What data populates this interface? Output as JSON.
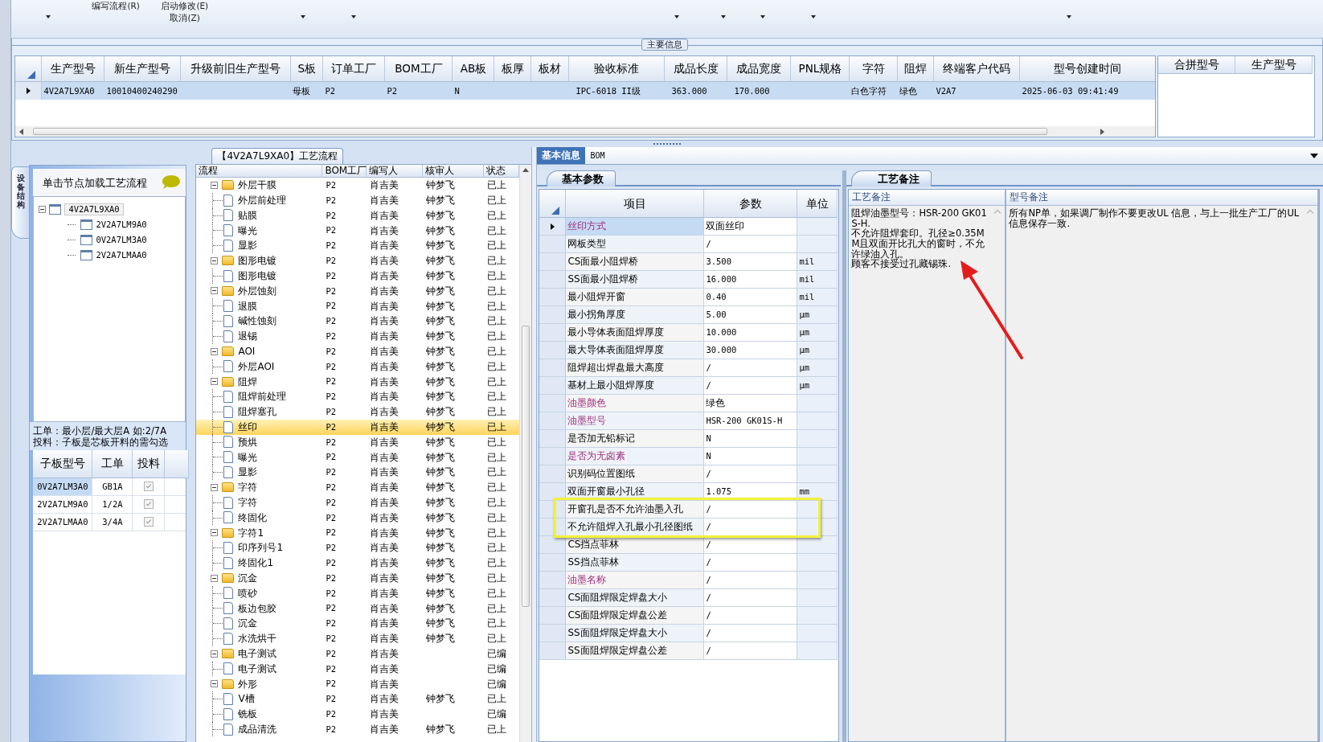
{
  "toolbar": {
    "commands": [
      {
        "label": "编写流程(R)"
      },
      {
        "label": "启动修改(E)"
      },
      {
        "label": "取消(Z)"
      }
    ]
  },
  "main_info": {
    "title": "主要信息",
    "columns": [
      "生产型号",
      "新生产型号",
      "升级前旧生产型号",
      "S板",
      "订单工厂",
      "BOM工厂",
      "AB板",
      "板厚",
      "板材",
      "验收标准",
      "成品长度",
      "成品宽度",
      "PNL规格",
      "字符",
      "阻焊",
      "终端客户代码",
      "型号创建时间"
    ],
    "rows": [
      {
        "selected": true,
        "cells": [
          "4V2A7L9XA0",
          "10010400240290",
          null,
          "母板",
          "P2",
          "P2",
          "N",
          null,
          null,
          "IPC-6018 II级",
          "363.000",
          "170.000",
          null,
          "白色字符",
          "绿色",
          "V2A7",
          "2025-06-03 09:41:49"
        ]
      }
    ],
    "side_columns": [
      "合拼型号",
      "生产型号"
    ]
  },
  "structure": {
    "tab": "设备结构",
    "hint": "单击节点加载工艺流程",
    "tree": [
      {
        "label": "4V2A7L9XA0",
        "expanded": true,
        "selected": true,
        "children": [
          {
            "label": "2V2A7LM9A0",
            "selected": false
          },
          {
            "label": "0V2A7LM3A0",
            "selected": false
          },
          {
            "label": "2V2A7LMAA0",
            "selected": false
          }
        ]
      }
    ],
    "notes": [
      "工单：最小层/最大层A 如:2/7A",
      "投料：子板是芯板开料的需勾选"
    ],
    "sub_table": {
      "columns": [
        "子板型号",
        "工单",
        "投料"
      ],
      "rows": [
        {
          "cells": [
            "0V2A7LM3A0",
            "GB1A"
          ],
          "checked": true,
          "selected": true
        },
        {
          "cells": [
            "2V2A7LM9A0",
            "1/2A"
          ],
          "checked": true,
          "selected": false
        },
        {
          "cells": [
            "2V2A7LMAA0",
            "3/4A"
          ],
          "checked": true,
          "selected": false
        }
      ]
    }
  },
  "flow": {
    "tab": "【4V2A7L9XA0】工艺流程",
    "columns": [
      "流程",
      "BOM工厂",
      "编写人",
      "核审人",
      "状态"
    ],
    "steps": [
      {
        "label": "外层干膜",
        "bom": "P2",
        "writer": "肖吉美",
        "reviewer": "钟梦飞",
        "status": "已上",
        "expanded": true,
        "selected": false,
        "children": [
          {
            "label": "外层前处理",
            "bom": "P2",
            "writer": "肖吉美",
            "reviewer": "钟梦飞",
            "status": "已上",
            "selected": false
          },
          {
            "label": "贴膜",
            "bom": "P2",
            "writer": "肖吉美",
            "reviewer": "钟梦飞",
            "status": "已上",
            "selected": false
          },
          {
            "label": "曝光",
            "bom": "P2",
            "writer": "肖吉美",
            "reviewer": "钟梦飞",
            "status": "已上",
            "selected": false
          },
          {
            "label": "显影",
            "bom": "P2",
            "writer": "肖吉美",
            "reviewer": "钟梦飞",
            "status": "已上",
            "selected": false
          }
        ]
      },
      {
        "label": "图形电镀",
        "bom": "P2",
        "writer": "肖吉美",
        "reviewer": "钟梦飞",
        "status": "已上",
        "expanded": true,
        "selected": false,
        "children": [
          {
            "label": "图形电镀",
            "bom": "P2",
            "writer": "肖吉美",
            "reviewer": "钟梦飞",
            "status": "已上",
            "selected": false
          }
        ]
      },
      {
        "label": "外层蚀刻",
        "bom": "P2",
        "writer": "肖吉美",
        "reviewer": "钟梦飞",
        "status": "已上",
        "expanded": true,
        "selected": false,
        "children": [
          {
            "label": "退膜",
            "bom": "P2",
            "writer": "肖吉美",
            "reviewer": "钟梦飞",
            "status": "已上",
            "selected": false
          },
          {
            "label": "碱性蚀刻",
            "bom": "P2",
            "writer": "肖吉美",
            "reviewer": "钟梦飞",
            "status": "已上",
            "selected": false
          },
          {
            "label": "退锡",
            "bom": "P2",
            "writer": "肖吉美",
            "reviewer": "钟梦飞",
            "status": "已上",
            "selected": false
          }
        ]
      },
      {
        "label": "AOI",
        "bom": "P2",
        "writer": "肖吉美",
        "reviewer": "钟梦飞",
        "status": "已上",
        "expanded": true,
        "selected": false,
        "children": [
          {
            "label": "外层AOI",
            "bom": "P2",
            "writer": "肖吉美",
            "reviewer": "钟梦飞",
            "status": "已上",
            "selected": false
          }
        ]
      },
      {
        "label": "阻焊",
        "bom": "P2",
        "writer": "肖吉美",
        "reviewer": "钟梦飞",
        "status": "已上",
        "expanded": true,
        "selected": false,
        "children": [
          {
            "label": "阻焊前处理",
            "bom": "P2",
            "writer": "肖吉美",
            "reviewer": "钟梦飞",
            "status": "已上",
            "selected": false
          },
          {
            "label": "阻焊塞孔",
            "bom": "P2",
            "writer": "肖吉美",
            "reviewer": "钟梦飞",
            "status": "已上",
            "selected": false
          },
          {
            "label": "丝印",
            "bom": "P2",
            "writer": "肖吉美",
            "reviewer": "钟梦飞",
            "status": "已上",
            "selected": true
          },
          {
            "label": "预烘",
            "bom": "P2",
            "writer": "肖吉美",
            "reviewer": "钟梦飞",
            "status": "已上",
            "selected": false
          },
          {
            "label": "曝光",
            "bom": "P2",
            "writer": "肖吉美",
            "reviewer": "钟梦飞",
            "status": "已上",
            "selected": false
          },
          {
            "label": "显影",
            "bom": "P2",
            "writer": "肖吉美",
            "reviewer": "钟梦飞",
            "status": "已上",
            "selected": false
          }
        ]
      },
      {
        "label": "字符",
        "bom": "P2",
        "writer": "肖吉美",
        "reviewer": "钟梦飞",
        "status": "已上",
        "expanded": true,
        "selected": false,
        "children": [
          {
            "label": "字符",
            "bom": "P2",
            "writer": "肖吉美",
            "reviewer": "钟梦飞",
            "status": "已上",
            "selected": false
          },
          {
            "label": "终固化",
            "bom": "P2",
            "writer": "肖吉美",
            "reviewer": "钟梦飞",
            "status": "已上",
            "selected": false
          }
        ]
      },
      {
        "label": "字符1",
        "bom": "P2",
        "writer": "肖吉美",
        "reviewer": "钟梦飞",
        "status": "已上",
        "expanded": true,
        "selected": false,
        "children": [
          {
            "label": "印序列号1",
            "bom": "P2",
            "writer": "肖吉美",
            "reviewer": "钟梦飞",
            "status": "已上",
            "selected": false
          },
          {
            "label": "终固化1",
            "bom": "P2",
            "writer": "肖吉美",
            "reviewer": "钟梦飞",
            "status": "已上",
            "selected": false
          }
        ]
      },
      {
        "label": "沉金",
        "bom": "P2",
        "writer": "肖吉美",
        "reviewer": "钟梦飞",
        "status": "已上",
        "expanded": true,
        "selected": false,
        "children": [
          {
            "label": "喷砂",
            "bom": "P2",
            "writer": "肖吉美",
            "reviewer": "钟梦飞",
            "status": "已上",
            "selected": false
          },
          {
            "label": "板边包胶",
            "bom": "P2",
            "writer": "肖吉美",
            "reviewer": "钟梦飞",
            "status": "已上",
            "selected": false
          },
          {
            "label": "沉金",
            "bom": "P2",
            "writer": "肖吉美",
            "reviewer": "钟梦飞",
            "status": "已上",
            "selected": false
          },
          {
            "label": "水洗烘干",
            "bom": "P2",
            "writer": "肖吉美",
            "reviewer": "钟梦飞",
            "status": "已上",
            "selected": false
          }
        ]
      },
      {
        "label": "电子测试",
        "bom": "P2",
        "writer": "肖吉美",
        "status": "已编",
        "expanded": true,
        "selected": false,
        "children": [
          {
            "label": "电子测试",
            "bom": "P2",
            "writer": "肖吉美",
            "status": "已编",
            "selected": false
          }
        ]
      },
      {
        "label": "外形",
        "bom": "P2",
        "writer": "肖吉美",
        "status": "已编",
        "expanded": true,
        "selected": false,
        "children": [
          {
            "label": "V槽",
            "bom": "P2",
            "writer": "肖吉美",
            "reviewer": "钟梦飞",
            "status": "已上",
            "selected": false
          },
          {
            "label": "铣板",
            "bom": "P2",
            "writer": "肖吉美",
            "status": "已编",
            "selected": false
          },
          {
            "label": "成品清洗",
            "bom": "P2",
            "writer": "肖吉美",
            "reviewer": "钟梦飞",
            "status": "已上",
            "selected": false
          }
        ]
      }
    ]
  },
  "detail_tabs": [
    {
      "label": "基本信息",
      "selected": true
    },
    {
      "label": "BOM",
      "selected": false
    }
  ],
  "params": {
    "tab": "基本参数",
    "columns": [
      "项目",
      "参数",
      "单位"
    ],
    "rows": [
      {
        "item": "丝印方式",
        "value": "双面丝印",
        "emphasized": true,
        "selected": true
      },
      {
        "item": "网板类型",
        "value": "/",
        "emphasized": false,
        "selected": false
      },
      {
        "item": "CS面最小阻焊桥",
        "value": "3.500",
        "unit": "mil",
        "emphasized": false,
        "selected": false
      },
      {
        "item": "SS面最小阻焊桥",
        "value": "16.000",
        "unit": "mil",
        "emphasized": false,
        "selected": false
      },
      {
        "item": "最小阻焊开窗",
        "value": "0.40",
        "unit": "mil",
        "emphasized": false,
        "selected": false
      },
      {
        "item": "最小拐角厚度",
        "value": "5.00",
        "unit": "μm",
        "emphasized": false,
        "selected": false
      },
      {
        "item": "最小导体表面阻焊厚度",
        "value": "10.000",
        "unit": "μm",
        "emphasized": false,
        "selected": false
      },
      {
        "item": "最大导体表面阻焊厚度",
        "value": "30.000",
        "unit": "μm",
        "emphasized": false,
        "selected": false
      },
      {
        "item": "阻焊超出焊盘最大高度",
        "value": "/",
        "unit": "μm",
        "emphasized": false,
        "selected": false
      },
      {
        "item": "基材上最小阻焊厚度",
        "value": "/",
        "unit": "μm",
        "emphasized": false,
        "selected": false
      },
      {
        "item": "油墨颜色",
        "value": "绿色",
        "emphasized": true,
        "selected": false
      },
      {
        "item": "油墨型号",
        "value": "HSR-200 GK01S-H",
        "emphasized": true,
        "selected": false
      },
      {
        "item": "是否加无铅标记",
        "value": "N",
        "emphasized": false,
        "selected": false
      },
      {
        "item": "是否为无卤素",
        "value": "N",
        "emphasized": true,
        "selected": false
      },
      {
        "item": "识别码位置图纸",
        "value": "/",
        "emphasized": false,
        "selected": false
      },
      {
        "item": "双面开窗最小孔径",
        "value": "1.075",
        "unit": "mm",
        "emphasized": false,
        "selected": false
      },
      {
        "item": "开窗孔是否不允许油墨入孔",
        "value": "/",
        "emphasized": false,
        "selected": false
      },
      {
        "item": "不允许阻焊入孔最小孔径图纸",
        "value": "/",
        "emphasized": false,
        "selected": false
      },
      {
        "item": "CS挡点菲林",
        "value": "/",
        "emphasized": false,
        "selected": false
      },
      {
        "item": "SS挡点菲林",
        "value": "/",
        "emphasized": false,
        "selected": false
      },
      {
        "item": "油墨名称",
        "value": "/",
        "emphasized": true,
        "selected": false
      },
      {
        "item": "CS面阻焊限定焊盘大小",
        "value": "/",
        "emphasized": false,
        "selected": false
      },
      {
        "item": "CS面阻焊限定焊盘公差",
        "value": "/",
        "emphasized": false,
        "selected": false
      },
      {
        "item": "SS面阻焊限定焊盘大小",
        "value": "/",
        "emphasized": false,
        "selected": false
      },
      {
        "item": "SS面阻焊限定焊盘公差",
        "value": "/",
        "emphasized": false,
        "selected": false
      }
    ]
  },
  "remarks": {
    "tab": "工艺备注",
    "columns": [
      {
        "label": "工艺备注",
        "lines": [
          "阻焊油墨型号：HSR-200 GK01S-H.",
          "不允许阻焊套印。孔径≥0.35MM且双面开比孔大的窗时，不允许绿油入孔。",
          "顾客不接受过孔藏锡珠."
        ]
      },
      {
        "label": "型号备注",
        "lines": [
          "所有NP单，如果调厂制作不要更改UL 信息，与上一批生产工厂的UL信息保存一致."
        ]
      }
    ]
  }
}
